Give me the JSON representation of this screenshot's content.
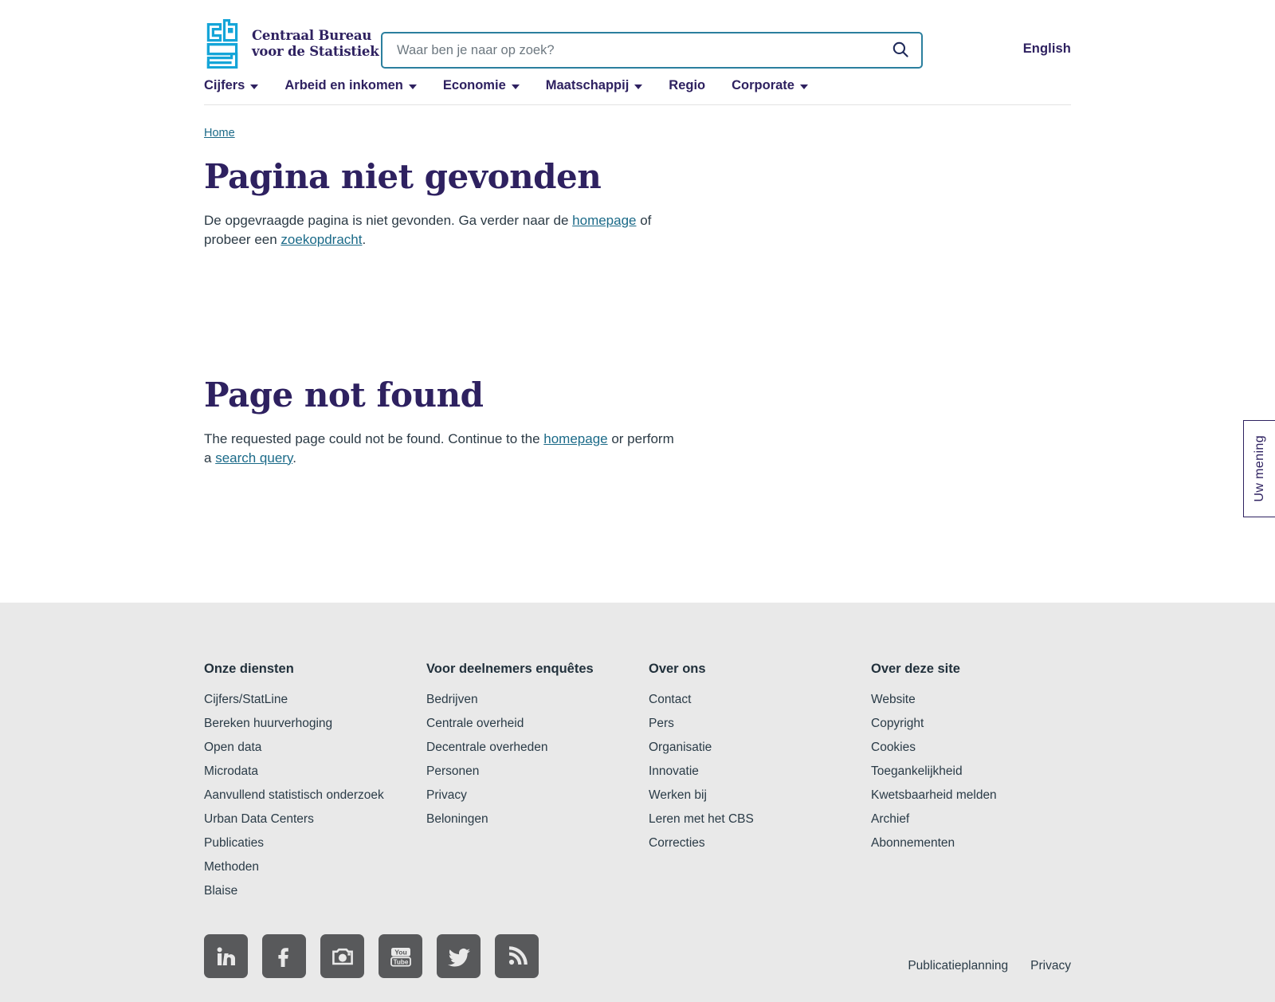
{
  "brand": {
    "logo_icon": "cbs-logo",
    "name_line1": "Centraal Bureau",
    "name_line2": "voor de Statistiek",
    "name_full": "Centraal Bureau\nvoor de Statistiek"
  },
  "search": {
    "placeholder": "Waar ben je naar op zoek?",
    "value": "",
    "icon": "search-icon",
    "button_label": ""
  },
  "language": {
    "label": "English"
  },
  "nav": {
    "items": [
      {
        "label": "Cijfers",
        "has_dropdown": true
      },
      {
        "label": "Arbeid en inkomen",
        "has_dropdown": true
      },
      {
        "label": "Economie",
        "has_dropdown": true
      },
      {
        "label": "Maatschappij",
        "has_dropdown": true
      },
      {
        "label": "Regio",
        "has_dropdown": false
      },
      {
        "label": "Corporate",
        "has_dropdown": true
      }
    ]
  },
  "breadcrumb": {
    "items": [
      {
        "label": "Home"
      }
    ]
  },
  "content": {
    "nl": {
      "heading": "Pagina niet gevonden",
      "text_before_link1": "De opgevraagde pagina is niet gevonden. Ga verder naar de ",
      "link1": "homepage",
      "text_between": " of probeer een ",
      "link2": "zoekopdracht",
      "text_after": "."
    },
    "en": {
      "heading": "Page not found",
      "text_before_link1": "The requested page could not be found. Continue to the ",
      "link1": "homepage",
      "text_between": " or perform a ",
      "link2": "search query",
      "text_after": "."
    }
  },
  "feedback": {
    "label": "Uw mening"
  },
  "footer": {
    "columns": [
      {
        "title": "Onze diensten",
        "links": [
          "Cijfers/StatLine",
          "Bereken huurverhoging",
          "Open data",
          "Microdata",
          "Aanvullend statistisch onderzoek",
          "Urban Data Centers",
          "Publicaties",
          "Methoden",
          "Blaise"
        ]
      },
      {
        "title": "Voor deelnemers enquêtes",
        "links": [
          "Bedrijven",
          "Centrale overheid",
          "Decentrale overheden",
          "Personen",
          "Privacy",
          "Beloningen"
        ]
      },
      {
        "title": "Over ons",
        "links": [
          "Contact",
          "Pers",
          "Organisatie",
          "Innovatie",
          "Werken bij",
          "Leren met het CBS",
          "Correcties"
        ]
      },
      {
        "title": "Over deze site",
        "links": [
          "Website",
          "Copyright",
          "Cookies",
          "Toegankelijkheid",
          "Kwetsbaarheid melden",
          "Archief",
          "Abonnementen"
        ]
      }
    ],
    "social": [
      {
        "name": "linkedin-icon",
        "label": "LinkedIn"
      },
      {
        "name": "facebook-icon",
        "label": "Facebook"
      },
      {
        "name": "instagram-icon",
        "label": "Instagram"
      },
      {
        "name": "youtube-icon",
        "label": "YouTube"
      },
      {
        "name": "twitter-icon",
        "label": "Twitter"
      },
      {
        "name": "rss-icon",
        "label": "RSS"
      }
    ],
    "legal_links": [
      "Publicatieplanning",
      "Privacy"
    ]
  },
  "colors": {
    "brand_navy": "#2e2160",
    "brand_cyan": "#15a5d8",
    "link_teal": "#1b6a88",
    "search_border": "#2b7f9e",
    "footer_bg": "#e9e9e9",
    "social_bg": "#58595b",
    "body_text": "#2b3a45"
  }
}
